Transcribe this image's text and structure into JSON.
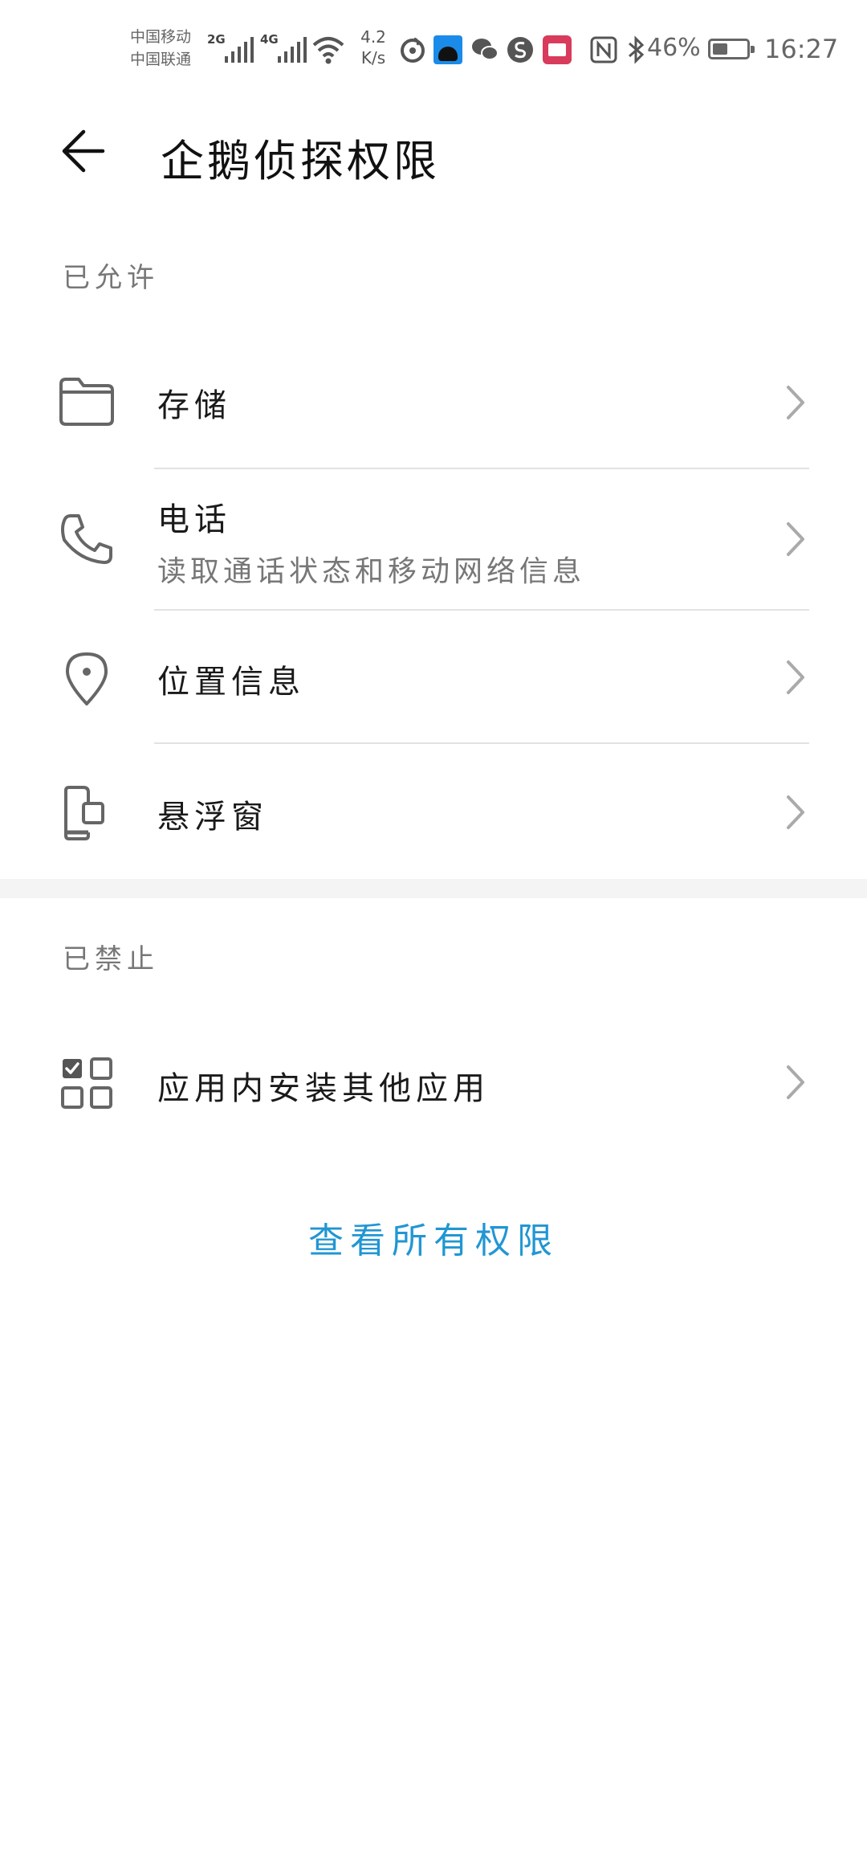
{
  "status_bar": {
    "carrier_1": "中国移动",
    "carrier_2": "中国联通",
    "sim1_network": "2G",
    "sim2_network": "4G",
    "speed_value": "4.2",
    "speed_unit": "K/s",
    "battery_percent": "46%",
    "battery_level": 0.46,
    "time": "16:27",
    "icons": [
      "netease-music-icon",
      "app-notification-icon",
      "wechat-icon",
      "sogou-icon",
      "tmall-icon",
      "nfc-icon",
      "bluetooth-icon"
    ]
  },
  "header": {
    "title": "企鹅侦探权限"
  },
  "allowed": {
    "section_label": "已允许",
    "items": [
      {
        "label": "存储",
        "icon": "folder-icon"
      },
      {
        "label": "电话",
        "sublabel": "读取通话状态和移动网络信息",
        "icon": "phone-icon"
      },
      {
        "label": "位置信息",
        "icon": "location-pin-icon"
      },
      {
        "label": "悬浮窗",
        "icon": "floating-window-icon"
      }
    ]
  },
  "denied": {
    "section_label": "已禁止",
    "items": [
      {
        "label": "应用内安装其他应用",
        "icon": "app-grid-icon"
      }
    ]
  },
  "footer": {
    "view_all_link": "查看所有权限",
    "link_color": "#2196d3"
  }
}
